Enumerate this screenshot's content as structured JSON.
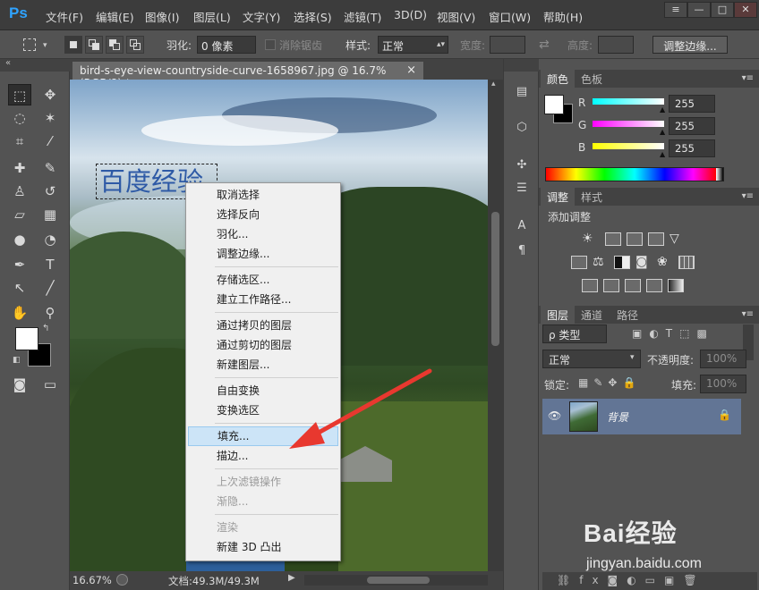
{
  "app": {
    "logo": "Ps"
  },
  "menu": [
    "文件(F)",
    "编辑(E)",
    "图像(I)",
    "图层(L)",
    "文字(Y)",
    "选择(S)",
    "滤镜(T)",
    "3D(D)",
    "视图(V)",
    "窗口(W)",
    "帮助(H)"
  ],
  "window_controls": [
    "≡",
    "—",
    "□",
    "✕"
  ],
  "options_bar": {
    "feather_label": "羽化:",
    "feather_value": "0 像素",
    "antialias_label": "消除锯齿",
    "style_label": "样式:",
    "style_value": "正常",
    "width_label": "宽度:",
    "height_label": "高度:",
    "refine_edge_button": "调整边缘..."
  },
  "document": {
    "tab_title": "bird-s-eye-view-countryside-curve-1658967.jpg @ 16.7%(RGB/8) *",
    "close": "×",
    "zoom": "16.67%",
    "doc_info": "文档:49.3M/49.3M",
    "text_layer_content": "百度经验"
  },
  "context_menu": {
    "items": [
      {
        "label": "取消选择",
        "state": "enabled"
      },
      {
        "label": "选择反向",
        "state": "enabled"
      },
      {
        "label": "羽化...",
        "state": "enabled"
      },
      {
        "label": "调整边缘...",
        "state": "enabled"
      },
      {
        "label": "存储选区...",
        "state": "enabled"
      },
      {
        "label": "建立工作路径...",
        "state": "enabled"
      },
      {
        "label": "通过拷贝的图层",
        "state": "enabled"
      },
      {
        "label": "通过剪切的图层",
        "state": "enabled"
      },
      {
        "label": "新建图层...",
        "state": "enabled"
      },
      {
        "label": "自由变换",
        "state": "enabled"
      },
      {
        "label": "变换选区",
        "state": "enabled"
      },
      {
        "label": "填充...",
        "state": "highlighted"
      },
      {
        "label": "描边...",
        "state": "enabled"
      },
      {
        "label": "上次滤镜操作",
        "state": "disabled"
      },
      {
        "label": "渐隐...",
        "state": "disabled"
      },
      {
        "label": "渲染",
        "state": "disabled"
      },
      {
        "label": "新建 3D 凸出",
        "state": "enabled"
      }
    ]
  },
  "color_panel": {
    "tabs": [
      "颜色",
      "色板"
    ],
    "channels": [
      {
        "label": "R",
        "value": "255"
      },
      {
        "label": "G",
        "value": "255"
      },
      {
        "label": "B",
        "value": "255"
      }
    ],
    "foreground": "#ffffff",
    "background": "#000000"
  },
  "adjustments_panel": {
    "tabs": [
      "调整",
      "样式"
    ],
    "title": "添加调整"
  },
  "layers_panel": {
    "tabs": [
      "图层",
      "通道",
      "路径"
    ],
    "kind_filter": "ρ 类型",
    "blend_mode": "正常",
    "opacity_label": "不透明度:",
    "opacity_value": "100%",
    "lock_label": "锁定:",
    "fill_label": "填充:",
    "fill_value": "100%",
    "layers": [
      {
        "name": "背景",
        "selected": true,
        "locked": true
      }
    ]
  },
  "watermark": {
    "logo": "Bai经验",
    "url": "jingyan.baidu.com"
  },
  "colors": {
    "accent": "#2fa3ff",
    "selection_highlight": "#cce4f7",
    "arrow": "#e8382f",
    "layer_selected": "#627595"
  }
}
